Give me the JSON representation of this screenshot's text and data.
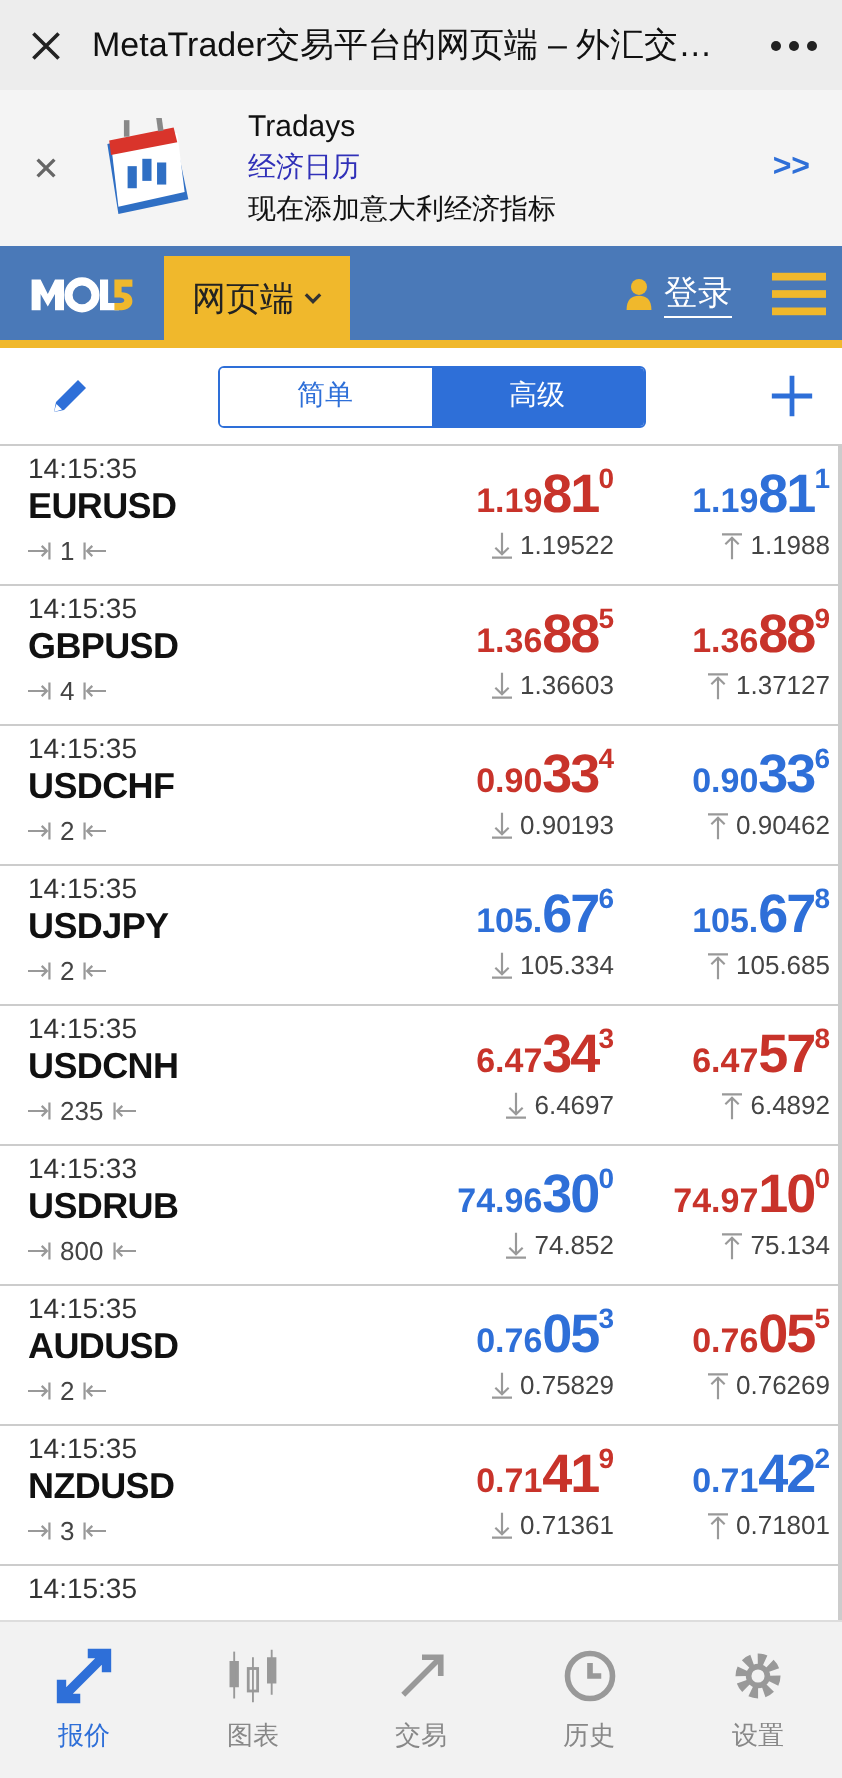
{
  "browser_bar": {
    "title": "MetaTrader交易平台的网页端 – 外汇交…"
  },
  "banner": {
    "title": "Tradays",
    "subtitle": "经济日历",
    "text": "现在添加意大利经济指标",
    "more": ">>"
  },
  "nav": {
    "section": "网页端",
    "login": "登录"
  },
  "view_toggle": [
    {
      "label": "简单",
      "selected": false
    },
    {
      "label": "高级",
      "selected": true
    }
  ],
  "quotes": [
    {
      "time": "14:15:35",
      "symbol": "EURUSD",
      "spread": "1",
      "bid": {
        "pre": "1.19",
        "big": "81",
        "sup": "0",
        "up": false
      },
      "low": "1.19522",
      "ask": {
        "pre": "1.19",
        "big": "81",
        "sup": "1",
        "up": true
      },
      "high": "1.1988"
    },
    {
      "time": "14:15:35",
      "symbol": "GBPUSD",
      "spread": "4",
      "bid": {
        "pre": "1.36",
        "big": "88",
        "sup": "5",
        "up": false
      },
      "low": "1.36603",
      "ask": {
        "pre": "1.36",
        "big": "88",
        "sup": "9",
        "up": false
      },
      "high": "1.37127"
    },
    {
      "time": "14:15:35",
      "symbol": "USDCHF",
      "spread": "2",
      "bid": {
        "pre": "0.90",
        "big": "33",
        "sup": "4",
        "up": false
      },
      "low": "0.90193",
      "ask": {
        "pre": "0.90",
        "big": "33",
        "sup": "6",
        "up": true
      },
      "high": "0.90462"
    },
    {
      "time": "14:15:35",
      "symbol": "USDJPY",
      "spread": "2",
      "bid": {
        "pre": "105.",
        "big": "67",
        "sup": "6",
        "up": true
      },
      "low": "105.334",
      "ask": {
        "pre": "105.",
        "big": "67",
        "sup": "8",
        "up": true
      },
      "high": "105.685"
    },
    {
      "time": "14:15:35",
      "symbol": "USDCNH",
      "spread": "235",
      "bid": {
        "pre": "6.47",
        "big": "34",
        "sup": "3",
        "up": false
      },
      "low": "6.4697",
      "ask": {
        "pre": "6.47",
        "big": "57",
        "sup": "8",
        "up": false
      },
      "high": "6.4892"
    },
    {
      "time": "14:15:33",
      "symbol": "USDRUB",
      "spread": "800",
      "bid": {
        "pre": "74.96",
        "big": "30",
        "sup": "0",
        "up": true
      },
      "low": "74.852",
      "ask": {
        "pre": "74.97",
        "big": "10",
        "sup": "0",
        "up": false
      },
      "high": "75.134"
    },
    {
      "time": "14:15:35",
      "symbol": "AUDUSD",
      "spread": "2",
      "bid": {
        "pre": "0.76",
        "big": "05",
        "sup": "3",
        "up": true
      },
      "low": "0.75829",
      "ask": {
        "pre": "0.76",
        "big": "05",
        "sup": "5",
        "up": false
      },
      "high": "0.76269"
    },
    {
      "time": "14:15:35",
      "symbol": "NZDUSD",
      "spread": "3",
      "bid": {
        "pre": "0.71",
        "big": "41",
        "sup": "9",
        "up": false
      },
      "low": "0.71361",
      "ask": {
        "pre": "0.71",
        "big": "42",
        "sup": "2",
        "up": true
      },
      "high": "0.71801"
    },
    {
      "time": "14:15:35"
    }
  ],
  "tab_bar": [
    {
      "label": "报价",
      "kind": "quotes",
      "selected": true
    },
    {
      "label": "图表",
      "kind": "charts",
      "selected": false
    },
    {
      "label": "交易",
      "kind": "trade",
      "selected": false
    },
    {
      "label": "历史",
      "kind": "history",
      "selected": false
    },
    {
      "label": "设置",
      "kind": "settings",
      "selected": false
    }
  ]
}
